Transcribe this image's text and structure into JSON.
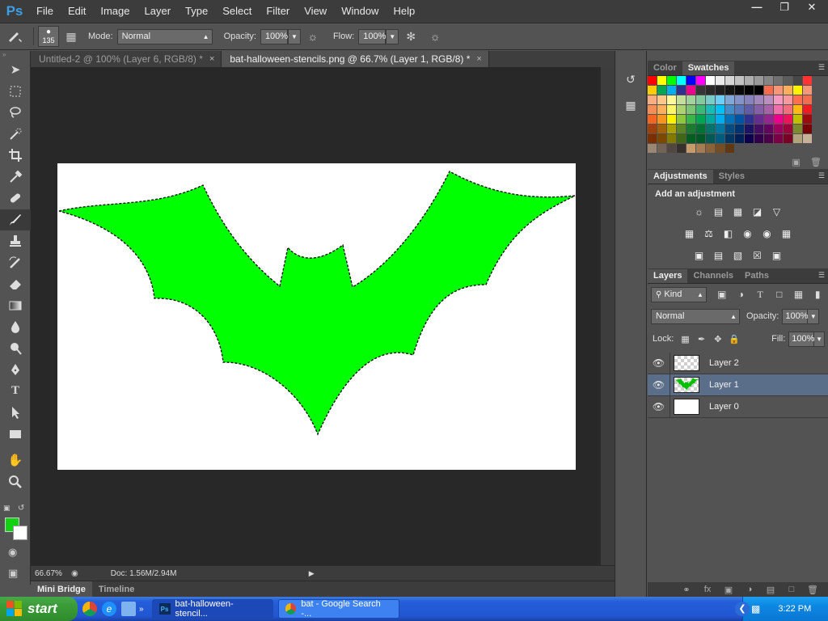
{
  "app": {
    "logo": "Ps",
    "menu": [
      "File",
      "Edit",
      "Image",
      "Layer",
      "Type",
      "Select",
      "Filter",
      "View",
      "Window",
      "Help"
    ],
    "window_controls": [
      "minimize",
      "restore",
      "close"
    ]
  },
  "options_bar": {
    "brush_size": "135",
    "mode_label": "Mode:",
    "mode_value": "Normal",
    "opacity_label": "Opacity:",
    "opacity_value": "100%",
    "flow_label": "Flow:",
    "flow_value": "100%"
  },
  "tabs": [
    {
      "label": "Untitled-2 @ 100% (Layer 6, RGB/8) *",
      "active": false
    },
    {
      "label": "bat-halloween-stencils.png @ 66.7% (Layer 1, RGB/8) *",
      "active": true
    }
  ],
  "tools": [
    "move-icon",
    "marquee-icon",
    "lasso-icon",
    "quick-select-icon",
    "crop-icon",
    "eyedropper-icon",
    "healing-icon",
    "brush-icon",
    "stamp-icon",
    "history-brush-icon",
    "eraser-icon",
    "gradient-icon",
    "blur-icon",
    "dodge-icon",
    "pen-icon",
    "type-icon",
    "path-select-icon",
    "rectangle-icon",
    "hand-icon",
    "zoom-icon"
  ],
  "colors": {
    "foreground": "#12d312",
    "background": "#ffffff",
    "bat_fill": "#00ff00",
    "accent": "#5b6e89"
  },
  "status": {
    "zoom": "66.67%",
    "doc": "Doc: 1.56M/2.94M"
  },
  "bottom_tabs": [
    "Mini Bridge",
    "Timeline"
  ],
  "panels": {
    "color_tabs": [
      "Color",
      "Swatches"
    ],
    "adjust_tabs": [
      "Adjustments",
      "Styles"
    ],
    "adjust_title": "Add an adjustment",
    "layer_tabs": [
      "Layers",
      "Channels",
      "Paths"
    ],
    "kind_label": "Kind",
    "blend_mode": "Normal",
    "opacity_label": "Opacity:",
    "opacity_value": "100%",
    "lock_label": "Lock:",
    "fill_label": "Fill:",
    "fill_value": "100%",
    "layers": [
      {
        "name": "Layer 2",
        "thumb": "transparent",
        "selected": false
      },
      {
        "name": "Layer 1",
        "thumb": "bat",
        "selected": true
      },
      {
        "name": "Layer 0",
        "thumb": "white",
        "selected": false
      }
    ]
  },
  "swatches": [
    "#ff0000",
    "#ffff00",
    "#00ff00",
    "#00ffff",
    "#0000ff",
    "#ff00ff",
    "#ffffff",
    "#ebebeb",
    "#d6d6d6",
    "#c2c2c2",
    "#adadad",
    "#999999",
    "#858585",
    "#707070",
    "#5c5c5c",
    "#474747",
    "#ff3333",
    "#ffcc00",
    "#00a651",
    "#00aeef",
    "#2e3192",
    "#ec008c",
    "#363636",
    "#2b2b2b",
    "#202020",
    "#151515",
    "#0a0a0a",
    "#000000",
    "#000000",
    "#f26c4f",
    "#f69679",
    "#fbaf5d",
    "#fff200",
    "#f7977a",
    "#f9ad81",
    "#fdc68a",
    "#fff79a",
    "#c4df9b",
    "#a3d39c",
    "#82ca9d",
    "#7accc8",
    "#6dcff6",
    "#7ea7d8",
    "#8393ca",
    "#8781bd",
    "#a187be",
    "#bc8dbf",
    "#f49ac2",
    "#f6989d",
    "#ff6d4f",
    "#f26c4f",
    "#f68e55",
    "#fbaf5d",
    "#fff568",
    "#acd372",
    "#7cc576",
    "#3bb878",
    "#1abbb4",
    "#00bff3",
    "#438ccb",
    "#5574b9",
    "#605ca8",
    "#855fa8",
    "#a763a8",
    "#f06ea9",
    "#f26d7d",
    "#fdb813",
    "#ed1c24",
    "#f26522",
    "#f7941d",
    "#fff200",
    "#8dc63f",
    "#39b54a",
    "#00a651",
    "#00a99d",
    "#00aeef",
    "#0072bc",
    "#0054a6",
    "#2e3192",
    "#662d91",
    "#92278f",
    "#ec008c",
    "#ed145b",
    "#c0c000",
    "#9e0b0f",
    "#a0410d",
    "#a36209",
    "#aba000",
    "#598527",
    "#1a7b30",
    "#007236",
    "#00746b",
    "#0076a3",
    "#004b80",
    "#003471",
    "#1b1464",
    "#440e62",
    "#630460",
    "#9e005d",
    "#9e0039",
    "#7e8b2c",
    "#790000",
    "#7b2e00",
    "#7d4900",
    "#827b00",
    "#406618",
    "#005e20",
    "#005826",
    "#005952",
    "#005b7f",
    "#003663",
    "#002157",
    "#0d004c",
    "#32004b",
    "#4b0049",
    "#7b0046",
    "#7a0026",
    "#b1a37b",
    "#c7b299",
    "#998675",
    "#736357",
    "#534741",
    "#37302d",
    "#c69c6d",
    "#a67c52",
    "#8c6239",
    "#754c24",
    "#603913"
  ],
  "taskbar": {
    "start": "start",
    "tasks": [
      {
        "label": "bat-halloween-stencil...",
        "active": true
      },
      {
        "label": "bat - Google Search -...",
        "active": false
      }
    ],
    "clock": "3:22 PM"
  }
}
